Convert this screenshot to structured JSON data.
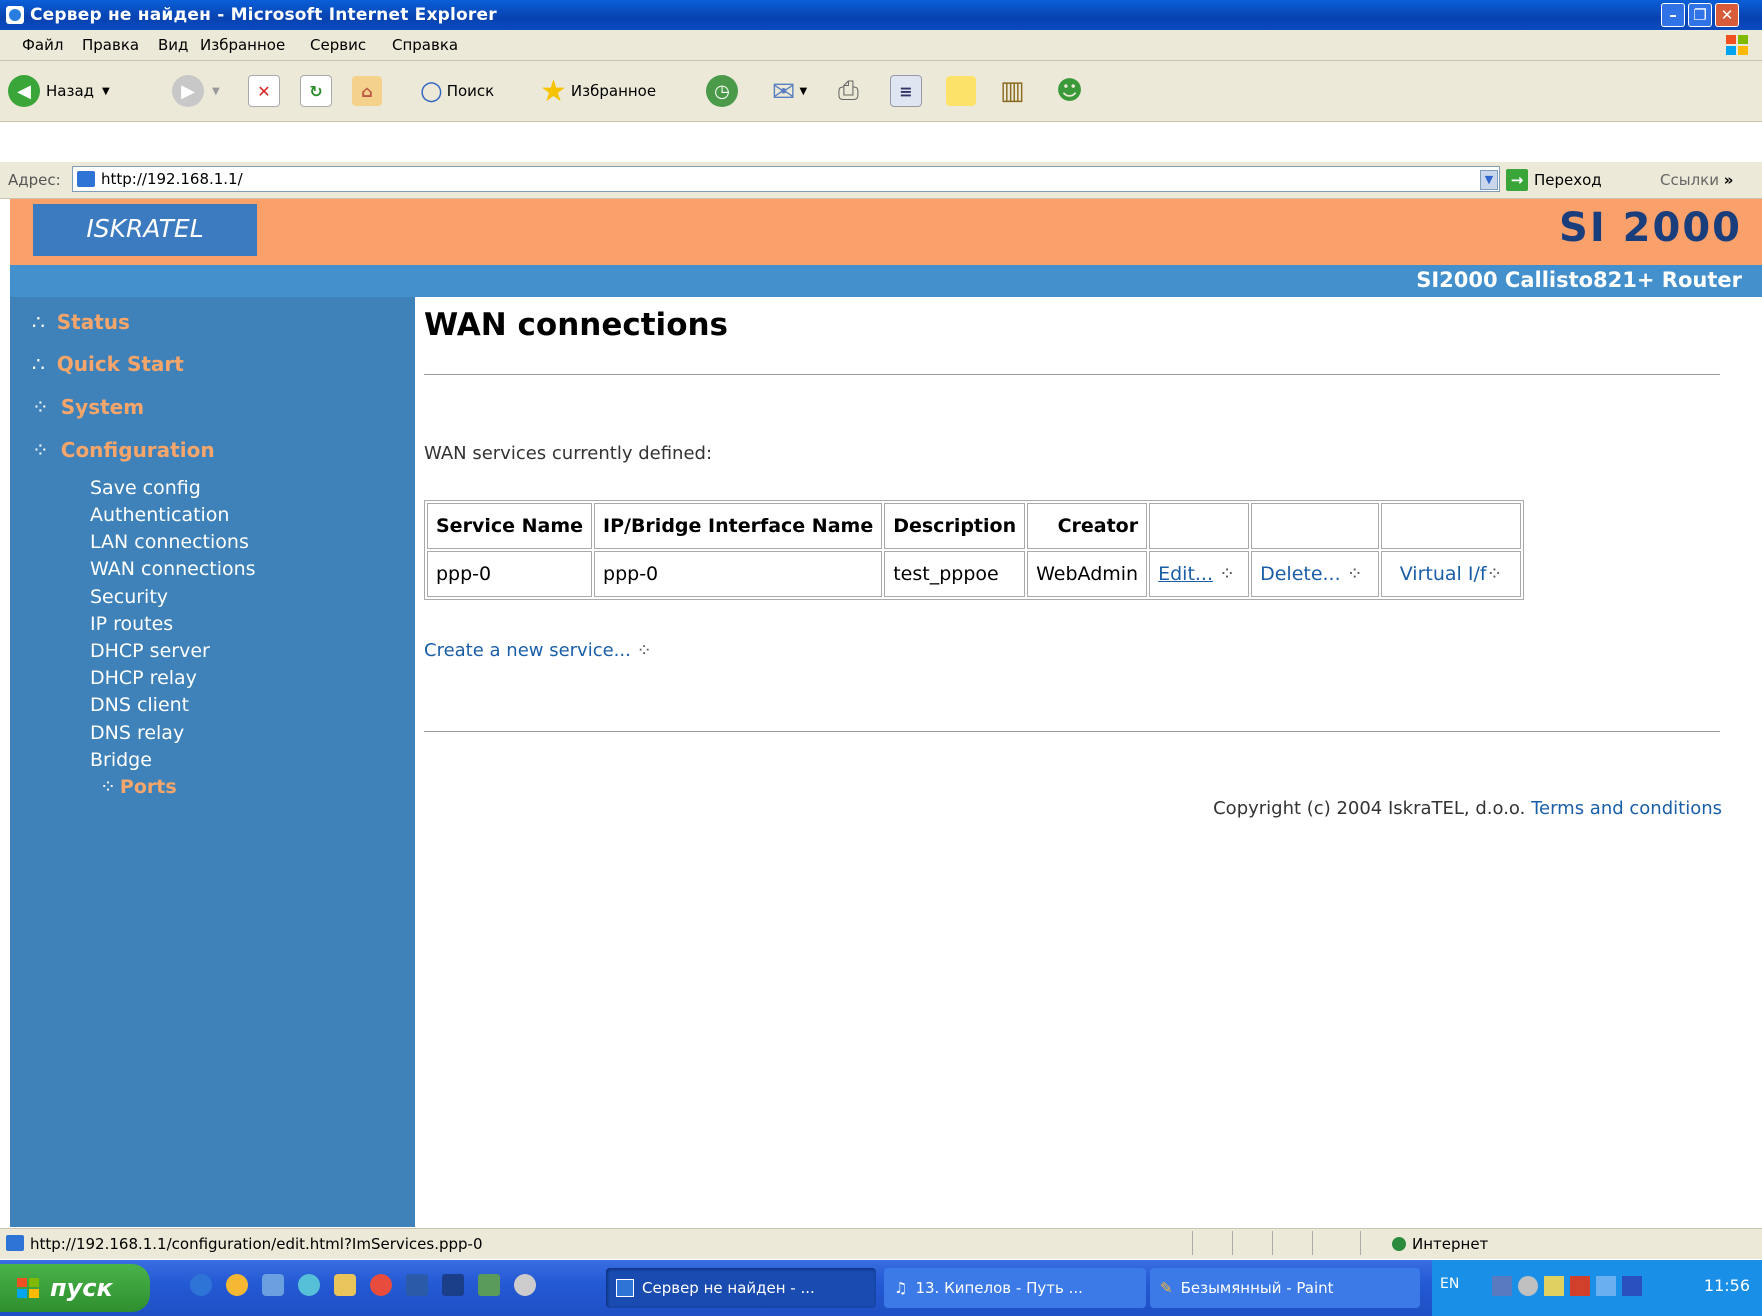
{
  "window": {
    "title": "Сервер не найден - Microsoft Internet Explorer"
  },
  "menu": [
    "Файл",
    "Правка",
    "Вид",
    "Избранное",
    "Сервис",
    "Справка"
  ],
  "toolbar": {
    "back": "Назад",
    "search": "Поиск",
    "favorites": "Избранное"
  },
  "address": {
    "label": "Адрес:",
    "url": "http://192.168.1.1/",
    "go": "Переход",
    "links": "Ссылки"
  },
  "header": {
    "logo": "ISKRATEL",
    "brand": "SI 2000",
    "router": "SI2000 Callisto821+ Router"
  },
  "sidebar": {
    "main": [
      "Status",
      "Quick Start",
      "System",
      "Configuration"
    ],
    "sub": [
      "Save config",
      "Authentication",
      "LAN connections",
      "WAN connections",
      "Security",
      "IP routes",
      "DHCP server",
      "DHCP relay",
      "DNS client",
      "DNS relay",
      "Bridge"
    ],
    "ports": "Ports"
  },
  "main": {
    "title": "WAN connections",
    "intro": "WAN services currently defined:",
    "table": {
      "headers": [
        "Service Name",
        "IP/Bridge Interface Name",
        "Description",
        "Creator"
      ],
      "row": [
        "ppp-0",
        "ppp-0",
        "test_pppoe",
        "WebAdmin"
      ],
      "actions": [
        "Edit...",
        "Delete...",
        "Virtual I/f"
      ]
    },
    "create": "Create a new service...",
    "copyright": "Copyright (c) 2004 IskraTEL, d.o.o.",
    "terms": "Terms and conditions"
  },
  "status": {
    "url": "http://192.168.1.1/configuration/edit.html?ImServices.ppp-0",
    "zone": "Интернет"
  },
  "taskbar": {
    "start": "пуск",
    "tasks": [
      "Сервер не найден - ...",
      "13. Кипелов - Путь ...",
      "Безымянный - Paint"
    ],
    "lang": "EN",
    "clock": "11:56"
  }
}
